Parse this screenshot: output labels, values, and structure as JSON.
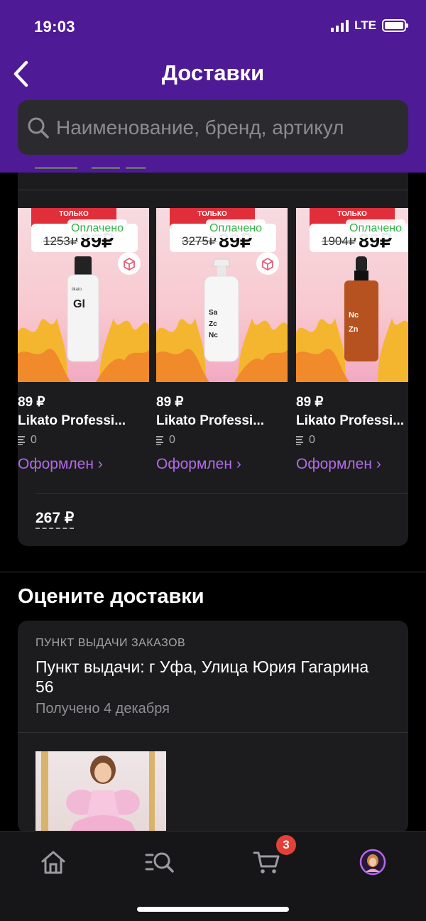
{
  "status_bar": {
    "time": "19:03",
    "network": "LTE"
  },
  "header": {
    "title": "Доставки",
    "back_icon": "chevron-left-icon"
  },
  "search": {
    "placeholder": "Наименование, бренд, артикул",
    "icon": "search-icon"
  },
  "order": {
    "products": [
      {
        "promo": "ТОЛЬКО",
        "old_price": "1253₽",
        "promo_price": "89₽",
        "paid": "Оплачено",
        "price": "89 ₽",
        "name": "Likato Professi...",
        "qty": "0",
        "status": "Оформлен ›",
        "label": "Gl"
      },
      {
        "promo": "ТОЛЬКО",
        "old_price": "3275₽",
        "promo_price": "89₽",
        "paid": "Оплачено",
        "price": "89 ₽",
        "name": "Likato Professi...",
        "qty": "0",
        "status": "Оформлен ›",
        "label": "Sa Zc Nc"
      },
      {
        "promo": "ТОЛЬКО",
        "old_price": "1904₽",
        "promo_price": "89₽",
        "paid": "Оплачено",
        "price": "89 ₽",
        "name": "Likato Professi...",
        "qty": "0",
        "status": "Оформлен ›",
        "label": "Nc Zn"
      }
    ],
    "total": "267 ₽"
  },
  "rate_section": {
    "title": "Оцените доставки",
    "card": {
      "kicker": "ПУНКТ ВЫДАЧИ ЗАКАЗОВ",
      "address": "Пункт выдачи: г Уфа, Улица Юрия Гагарина 56",
      "date": "Получено 4 декабря"
    }
  },
  "tabbar": {
    "tabs": [
      {
        "icon": "home-icon"
      },
      {
        "icon": "catalog-search-icon"
      },
      {
        "icon": "cart-icon"
      },
      {
        "icon": "profile-avatar-icon"
      }
    ],
    "cart_badge": "3"
  },
  "colors": {
    "header_bg": "#4e1a95",
    "accent": "#b26ae8",
    "paid_green": "#34b24a",
    "badge_red": "#e2413a"
  }
}
